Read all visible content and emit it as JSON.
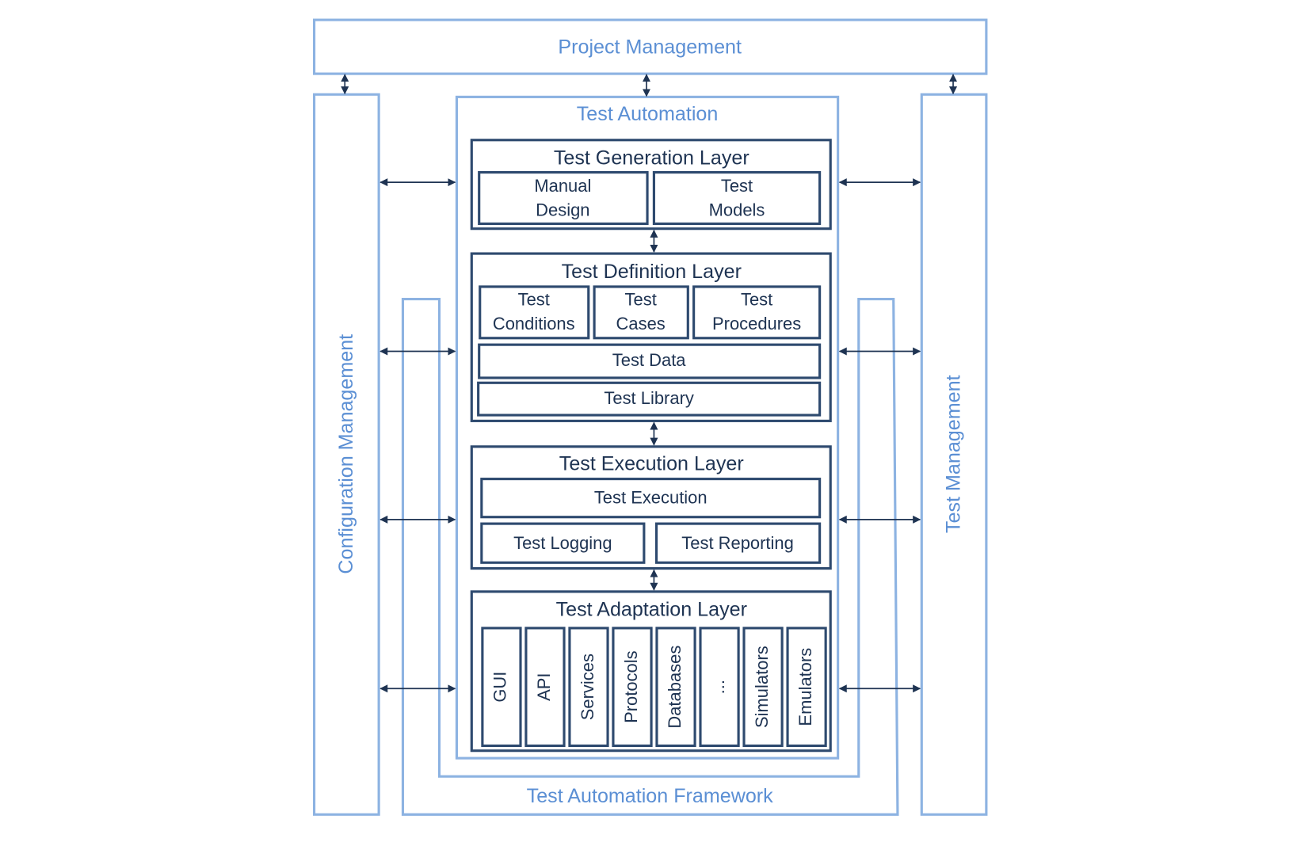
{
  "project_management": "Project Management",
  "configuration_management": "Configuration Management",
  "test_management": "Test Management",
  "test_automation_framework": "Test Automation Framework",
  "test_automation": "Test Automation",
  "generation_layer": {
    "title": "Test Generation Layer",
    "items": [
      [
        "Manual",
        "Design"
      ],
      [
        "Test",
        "Models"
      ]
    ]
  },
  "definition_layer": {
    "title": "Test Definition Layer",
    "items": [
      [
        "Test",
        "Conditions"
      ],
      [
        "Test",
        "Cases"
      ],
      [
        "Test",
        "Procedures"
      ]
    ],
    "test_data": "Test Data",
    "test_library": "Test Library"
  },
  "execution_layer": {
    "title": "Test Execution Layer",
    "test_execution": "Test Execution",
    "test_logging": "Test Logging",
    "test_reporting": "Test Reporting"
  },
  "adaptation_layer": {
    "title": "Test Adaptation Layer",
    "items": [
      "GUI",
      "API",
      "Services",
      "Protocols",
      "Databases",
      "...",
      "Simulators",
      "Emulators"
    ]
  },
  "colors": {
    "light_blue": "#8db3e2",
    "dark_blue": "#2e4a6f"
  }
}
